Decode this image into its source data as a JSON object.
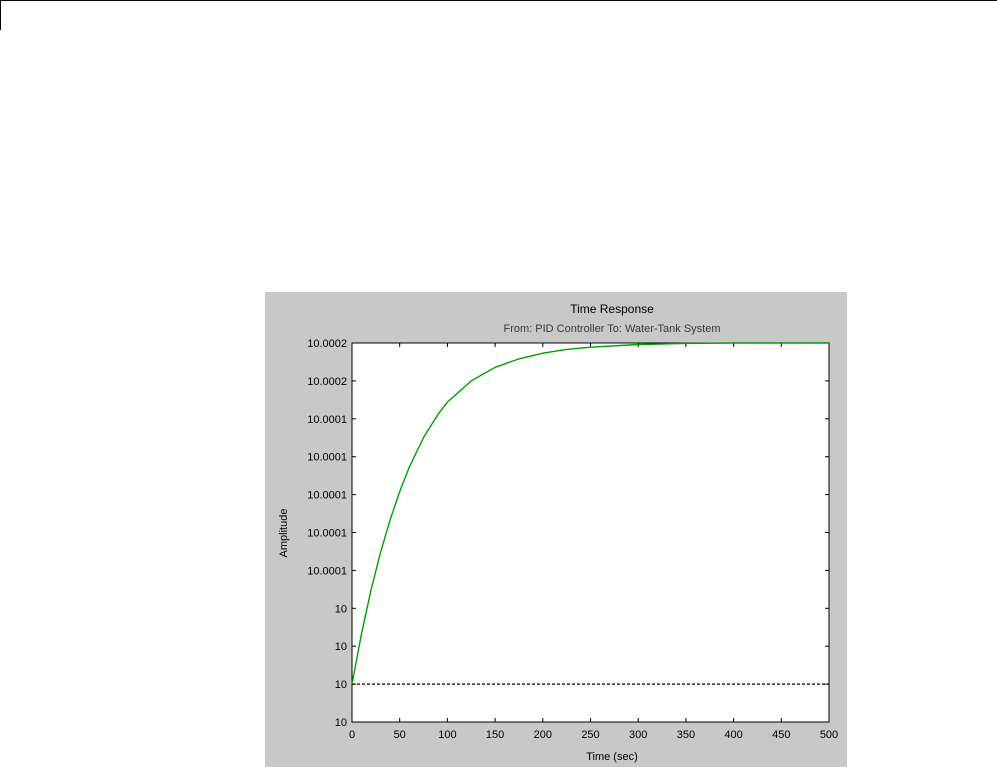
{
  "chart_data": {
    "type": "line",
    "title": "Time Response",
    "subtitle": "From: PID Controller  To: Water-Tank System",
    "xlabel": "Time (sec)",
    "ylabel": "Amplitude",
    "xlim": [
      0,
      500
    ],
    "ylim": [
      0,
      10
    ],
    "x_ticks": [
      0,
      50,
      100,
      150,
      200,
      250,
      300,
      350,
      400,
      450,
      500
    ],
    "x_tick_labels": [
      "0",
      "50",
      "100",
      "150",
      "200",
      "250",
      "300",
      "350",
      "400",
      "450",
      "500"
    ],
    "y_ticks": [
      0,
      1,
      2,
      3,
      4,
      5,
      6,
      7,
      8,
      9,
      10
    ],
    "y_tick_labels": [
      "10",
      "10",
      "10",
      "10",
      "10.0001",
      "10.0001",
      "10.0001",
      "10.0001",
      "10.0001",
      "10.0002",
      "10.0002"
    ],
    "grid": false,
    "series": [
      {
        "color": "#00a000",
        "x": [
          0,
          10,
          20,
          30,
          40,
          50,
          60,
          75,
          90,
          100,
          125,
          150,
          175,
          200,
          225,
          250,
          300,
          350,
          400,
          450,
          500
        ],
        "y": [
          1.0,
          2.33,
          3.49,
          4.48,
          5.34,
          6.08,
          6.72,
          7.51,
          8.11,
          8.44,
          9.0,
          9.36,
          9.58,
          9.73,
          9.83,
          9.89,
          9.96,
          9.99,
          10.0,
          10.0,
          10.0
        ]
      }
    ],
    "reference_line": {
      "y": 1,
      "style": "dashed",
      "color": "#000000"
    }
  }
}
